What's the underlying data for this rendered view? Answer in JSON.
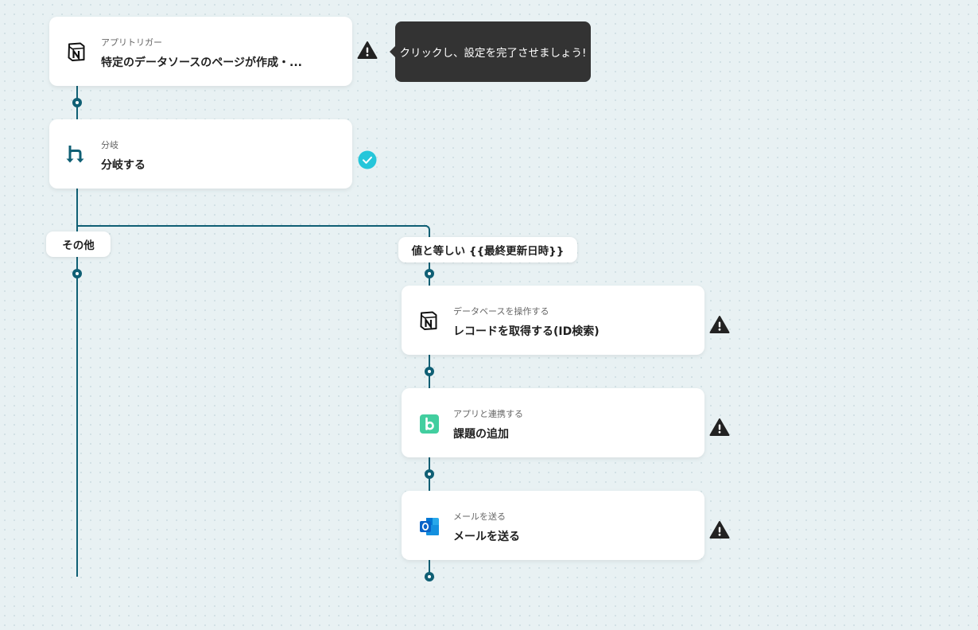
{
  "flow": {
    "trigger": {
      "subtitle": "アプリトリガー",
      "title": "特定のデータソースのページが作成・...",
      "icon": "notion-icon",
      "status": "warning-icon"
    },
    "tooltip": "クリックし、設定を完了させましょう!",
    "branch": {
      "subtitle": "分岐",
      "title": "分岐する",
      "icon": "branch-icon",
      "status": "check-icon"
    },
    "branch_labels": {
      "other": "その他",
      "condition": "値と等しい {{最終更新日時}}"
    },
    "steps": [
      {
        "subtitle": "データベースを操作する",
        "title": "レコードを取得する(ID検索)",
        "icon": "notion-icon",
        "status": "warning-icon"
      },
      {
        "subtitle": "アプリと連携する",
        "title": "課題の追加",
        "icon": "backlog-icon",
        "status": "warning-icon"
      },
      {
        "subtitle": "メールを送る",
        "title": "メールを送る",
        "icon": "outlook-icon",
        "status": "warning-icon"
      }
    ]
  },
  "colors": {
    "connector": "#0f5f74",
    "warning": "#222222",
    "success": "#26c6da",
    "backlog": "#42ce9f",
    "outlook": "#0a64c8"
  }
}
